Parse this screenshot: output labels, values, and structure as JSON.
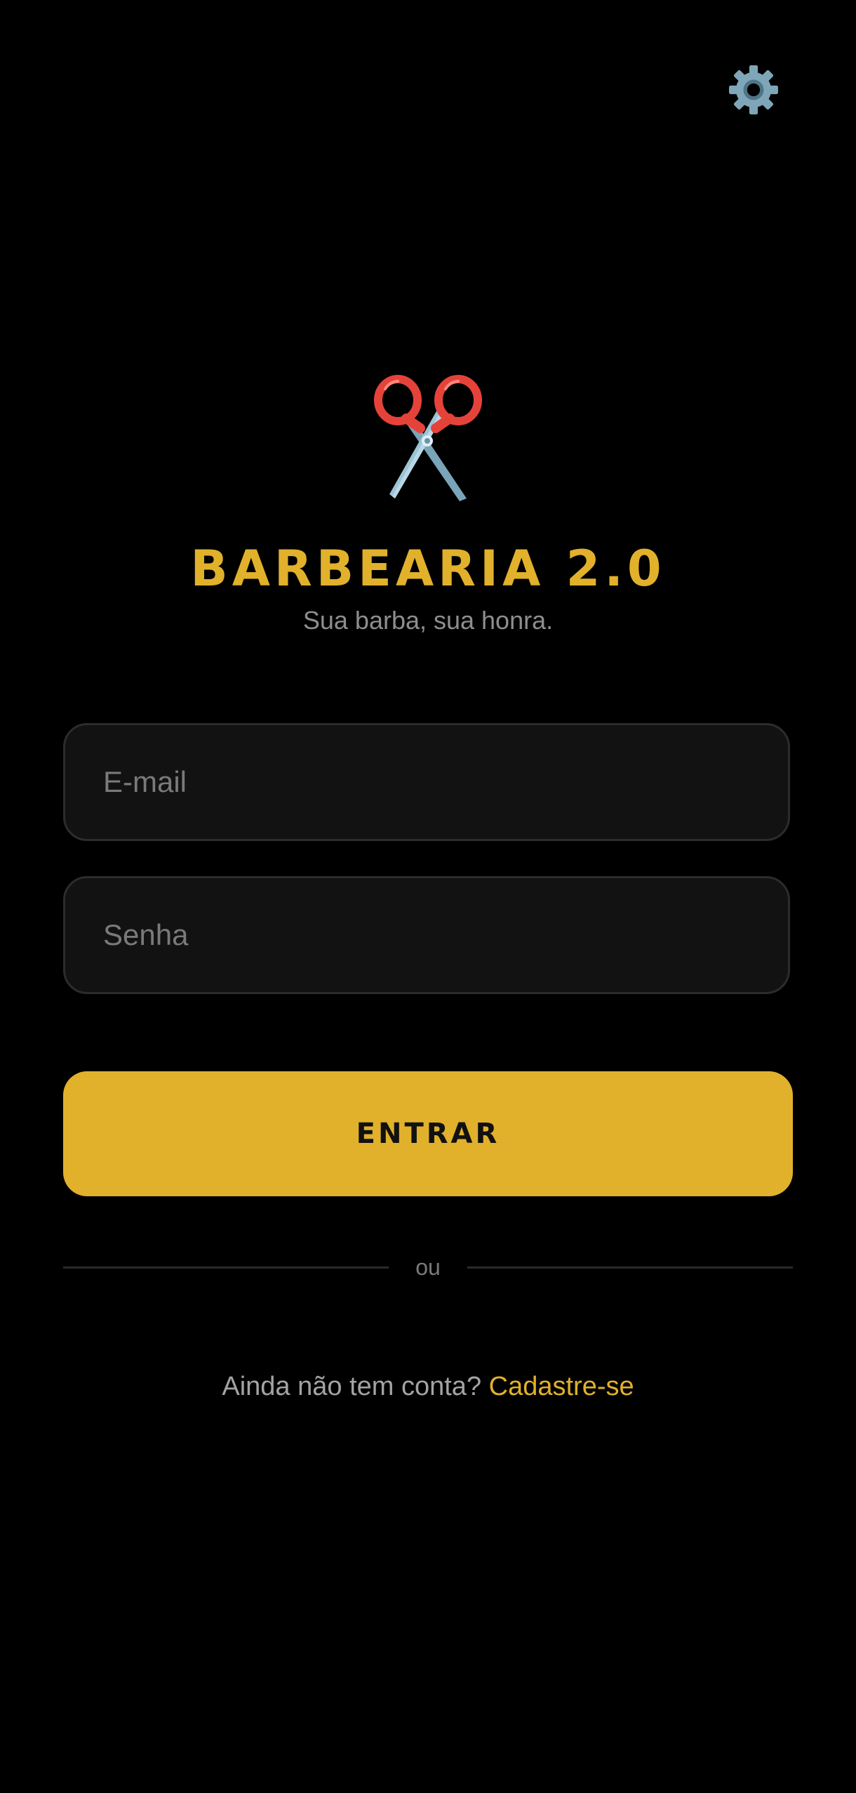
{
  "header": {
    "settings_icon": "gear-icon"
  },
  "brand": {
    "logo_icon": "scissors-icon",
    "title": "BARBEARIA 2.0",
    "tagline": "Sua barba, sua honra."
  },
  "form": {
    "email": {
      "placeholder": "E-mail",
      "value": ""
    },
    "password": {
      "placeholder": "Senha",
      "value": ""
    },
    "submit_label": "ENTRAR"
  },
  "divider": {
    "text": "ou"
  },
  "signup": {
    "prompt": "Ainda não tem conta?",
    "link_label": "Cadastre-se"
  },
  "colors": {
    "background": "#000000",
    "accent": "#e1b12c",
    "field_background": "#121212",
    "field_border": "#2c2c2c",
    "muted_text": "#8e8e8e",
    "scissors_handle": "#e5433a",
    "scissors_blade": "#8fb6c9",
    "gear": "#7fa6b8"
  }
}
